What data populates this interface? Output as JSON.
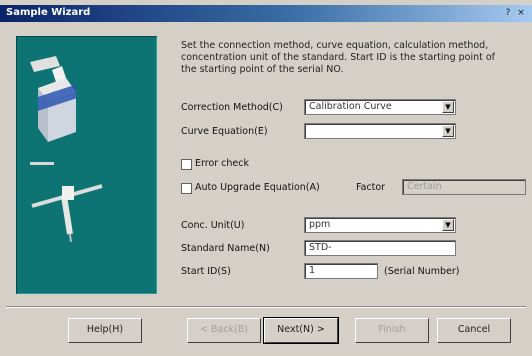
{
  "window": {
    "title": "Sample Wizard",
    "help_glyph": "?",
    "close_glyph": "×"
  },
  "description": "Set the connection method, curve equation, calculation method, concentration unit of the standard. Start ID is the starting point of the starting point of the serial NO.",
  "fields": {
    "correction_method": {
      "label": "Correction Method(C)",
      "value": "Calibration Curve"
    },
    "curve_equation": {
      "label": "Curve Equation(E)",
      "value": ""
    },
    "error_check": {
      "label": "Error check"
    },
    "auto_upgrade": {
      "label": "Auto Upgrade Equation(A)",
      "factor_label": "Factor",
      "factor_value": "Certain"
    },
    "conc_unit": {
      "label": "Conc. Unit(U)",
      "value": "ppm"
    },
    "standard_name": {
      "label": "Standard Name(N)",
      "value": "STD-"
    },
    "start_id": {
      "label": "Start ID(S)",
      "value": "1",
      "hint": "(Serial Number)"
    }
  },
  "buttons": {
    "help": "Help(H)",
    "back": "< Back(B)",
    "next": "Next(N) >",
    "finish": "Finish",
    "cancel": "Cancel"
  },
  "colors": {
    "panel": "#0e7373",
    "titlebar": "#0a246a"
  }
}
